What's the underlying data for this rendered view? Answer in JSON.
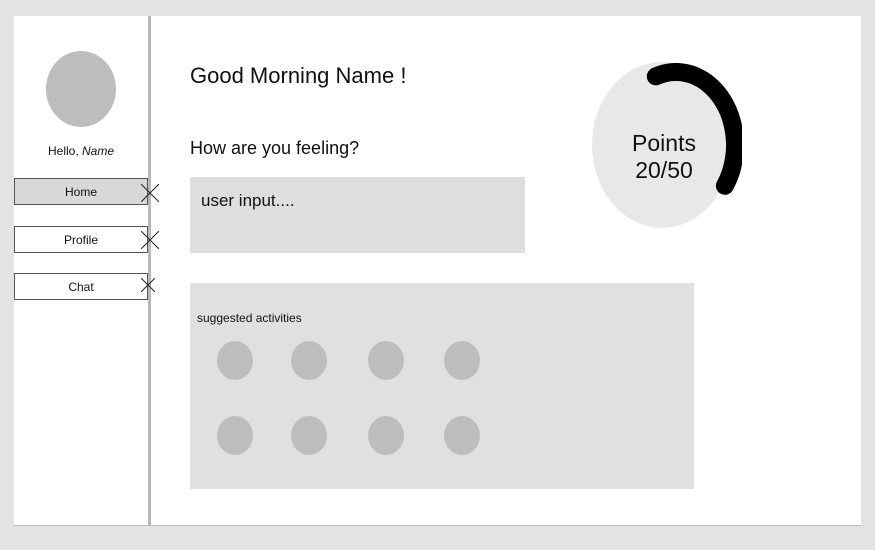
{
  "sidebar": {
    "hello_prefix": "Hello, ",
    "hello_name": "Name",
    "nav": [
      {
        "label": "Home",
        "active": true
      },
      {
        "label": "Profile",
        "active": false
      },
      {
        "label": "Chat",
        "active": false
      }
    ]
  },
  "main": {
    "title": "Good Morning Name !",
    "feeling_question": "How are you feeling?",
    "input_placeholder": "user input...."
  },
  "points": {
    "label": "Points",
    "value": "20/50",
    "current": 20,
    "max": 50
  },
  "activities": {
    "title": "suggested activities",
    "count": 8
  },
  "colors": {
    "background": "#e3e3e3",
    "panel": "#ffffff",
    "placeholder_gray": "#bdbdbd",
    "input_bg": "#dedede",
    "activities_bg": "#e0e0e0",
    "points_circle": "#e8e8e8",
    "points_arc": "#000000"
  }
}
